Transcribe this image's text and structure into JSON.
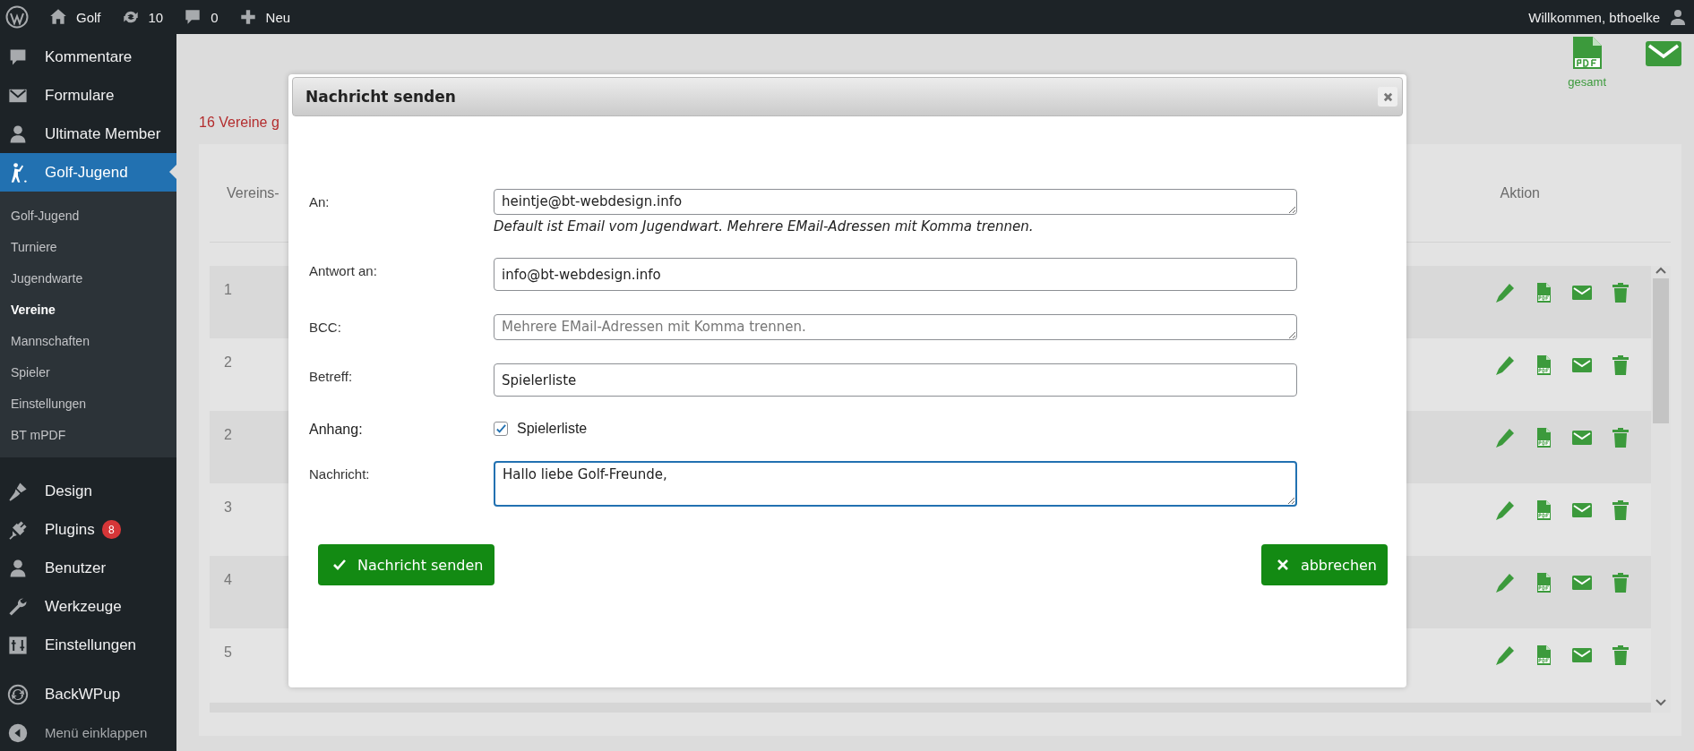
{
  "top_bar": {
    "items": [
      {
        "kind": "home",
        "label": "Golf"
      },
      {
        "kind": "updates",
        "label": "10"
      },
      {
        "kind": "comments",
        "label": "0"
      },
      {
        "kind": "new",
        "label": "Neu"
      }
    ],
    "account": "Willkommen, bthoelke"
  },
  "sidebar": {
    "items": [
      {
        "kind": "comments",
        "label": "Kommentare",
        "selected": false
      },
      {
        "kind": "mail",
        "label": "Formulare",
        "selected": false
      },
      {
        "kind": "user",
        "label": "Ultimate Member",
        "selected": false
      },
      {
        "kind": "golfer",
        "label": "Golf-Jugend",
        "selected": true,
        "children": [
          {
            "label": "Golf-Jugend",
            "selected": false
          },
          {
            "label": "Turniere",
            "selected": false
          },
          {
            "label": "Jugendwarte",
            "selected": false
          },
          {
            "label": "Vereine",
            "selected": true
          },
          {
            "label": "Mannschaften",
            "selected": false
          },
          {
            "label": "Spieler",
            "selected": false
          },
          {
            "label": "Einstellungen",
            "selected": false
          },
          {
            "label": "BT mPDF",
            "selected": false
          }
        ]
      },
      {
        "kind": "brush",
        "label": "Design",
        "selected": false
      },
      {
        "kind": "plug",
        "label": "Plugins",
        "selected": false,
        "badge": "8"
      },
      {
        "kind": "user",
        "label": "Benutzer",
        "selected": false
      },
      {
        "kind": "wrench",
        "label": "Werkzeuge",
        "selected": false
      },
      {
        "kind": "settings",
        "label": "Einstellungen",
        "selected": false
      },
      {
        "kind": "backup",
        "label": "BackWPup",
        "selected": false
      },
      {
        "kind": "collapse",
        "label": "Menü einklappen",
        "selected": false
      }
    ]
  },
  "page": {
    "summary": "16 Vereine g",
    "export_label": "gesamt",
    "table": {
      "columns": [
        "Vereins-",
        "Aktion"
      ],
      "rows": [
        {
          "number": "1"
        },
        {
          "number": "2"
        },
        {
          "number": "2"
        },
        {
          "number": "3"
        },
        {
          "number": "4"
        },
        {
          "number": "5"
        }
      ]
    }
  },
  "dialog": {
    "title": "Nachricht senden",
    "fields": [
      {
        "kind": "textarea",
        "label": "An:",
        "value": "heintje@bt-webdesign.info",
        "hint": "Default ist Email vom Jugendwart. Mehrere EMail-Adressen mit Komma trennen."
      },
      {
        "kind": "input",
        "label": "Antwort an:",
        "value": "info@bt-webdesign.info"
      },
      {
        "kind": "textarea",
        "label": "BCC:",
        "placeholder": "Mehrere EMail-Adressen mit Komma trennen."
      },
      {
        "kind": "input",
        "label": "Betreff:",
        "value": "Spielerliste"
      },
      {
        "kind": "checkbox",
        "label": "Anhang:",
        "option": "Spielerliste",
        "checked": true
      },
      {
        "kind": "message",
        "label": "Nachricht:",
        "value": "Hallo liebe Golf-Freunde,",
        "focused": true
      }
    ],
    "buttons": [
      {
        "kind": "confirm",
        "label": "Nachricht senden"
      },
      {
        "kind": "cancel",
        "label": "abbrechen"
      }
    ]
  }
}
